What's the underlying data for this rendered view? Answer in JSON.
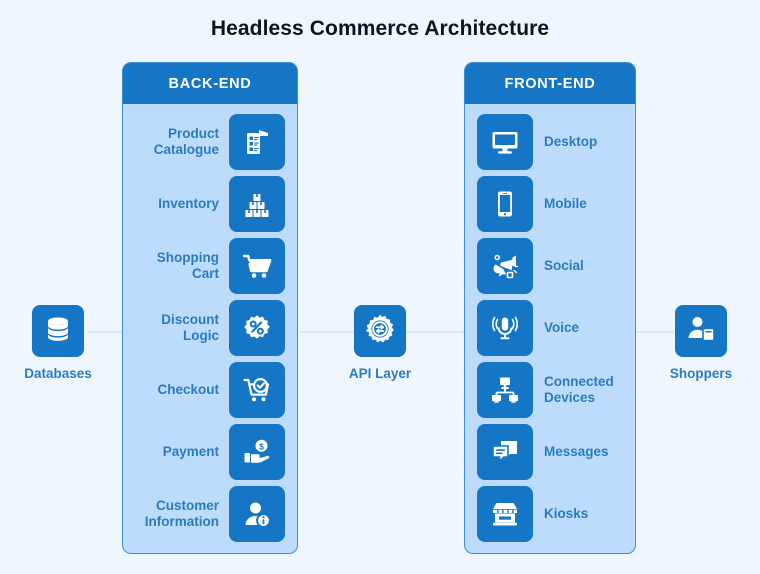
{
  "title": "Headless Commerce Architecture",
  "colors": {
    "background": "#f0f6fd",
    "panel_body": "#bddcfb",
    "panel_border": "#3b8fd4",
    "accent_blue": "#1576c6",
    "label_blue": "#2a7cc1",
    "title_black": "#10151c",
    "connector": "#d6e7f8"
  },
  "backend": {
    "header": "BACK-END",
    "items": [
      {
        "label": "Product Catalogue",
        "icon": "document-list-icon"
      },
      {
        "label": "Inventory",
        "icon": "stacked-boxes-icon"
      },
      {
        "label": "Shopping Cart",
        "icon": "shopping-cart-icon"
      },
      {
        "label": "Discount Logic",
        "icon": "percent-badge-icon"
      },
      {
        "label": "Checkout",
        "icon": "cart-check-icon"
      },
      {
        "label": "Payment",
        "icon": "hand-money-icon"
      },
      {
        "label": "Customer Information",
        "icon": "user-info-icon"
      }
    ]
  },
  "frontend": {
    "header": "FRONT-END",
    "items": [
      {
        "label": "Desktop",
        "icon": "monitor-icon"
      },
      {
        "label": "Mobile",
        "icon": "smartphone-icon"
      },
      {
        "label": "Social",
        "icon": "megaphone-icon"
      },
      {
        "label": "Voice",
        "icon": "microphone-icon"
      },
      {
        "label": "Connected Devices",
        "icon": "network-devices-icon"
      },
      {
        "label": "Messages",
        "icon": "chat-bubbles-icon"
      },
      {
        "label": "Kiosks",
        "icon": "storefront-icon"
      }
    ]
  },
  "side_nodes": {
    "databases": {
      "label": "Databases",
      "icon": "database-icon"
    },
    "api_layer": {
      "label": "API Layer",
      "icon": "gear-exchange-icon"
    },
    "shoppers": {
      "label": "Shoppers",
      "icon": "shopper-bag-icon"
    }
  }
}
